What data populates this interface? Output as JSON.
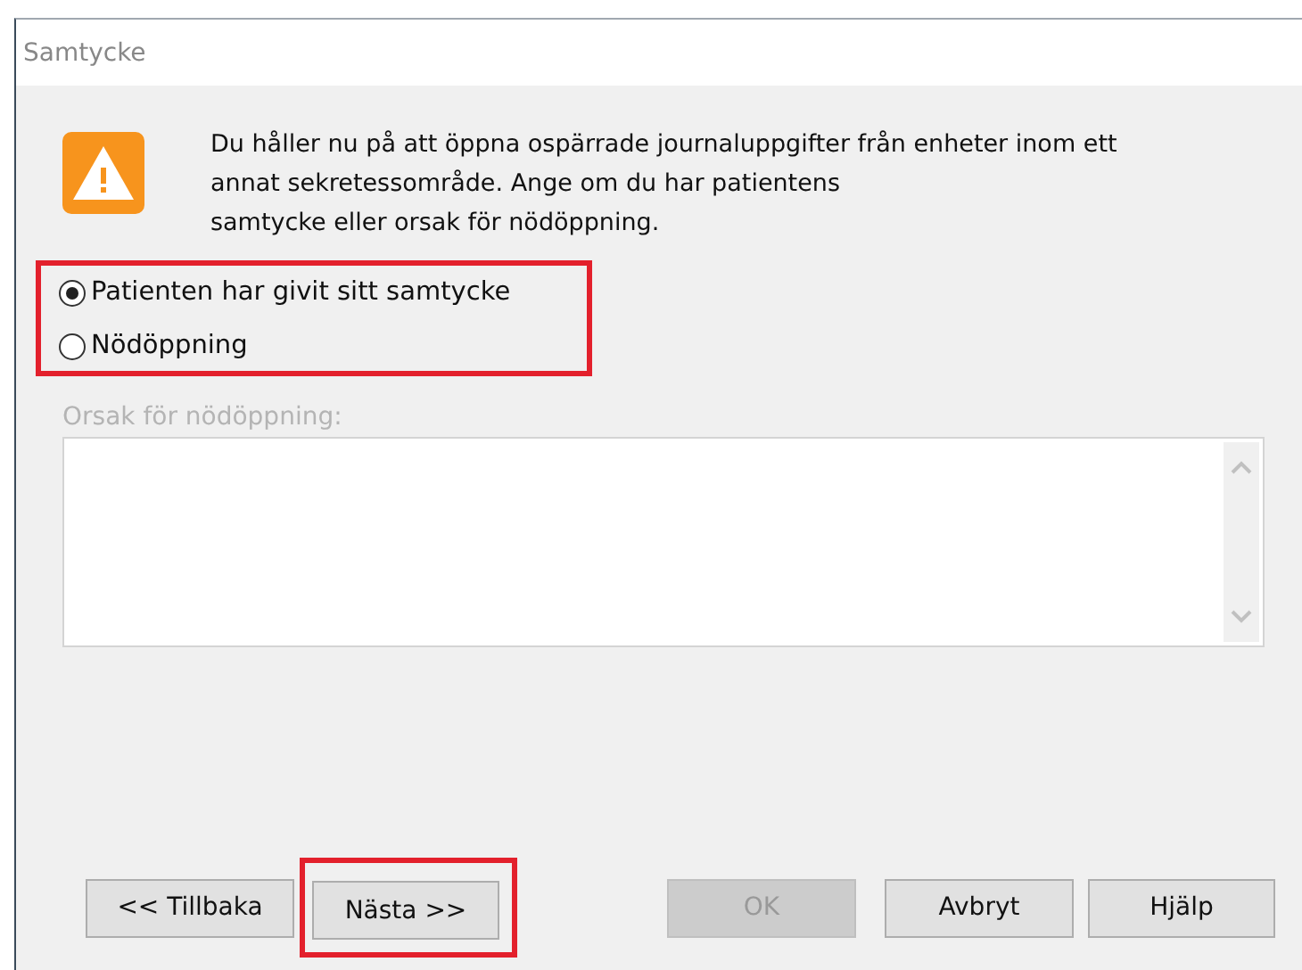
{
  "window": {
    "title": "Samtycke"
  },
  "message": "Du håller nu på att öppna ospärrade journaluppgifter från enheter inom ett\nannat sekretessområde. Ange om du har patientens\nsamtycke eller orsak för nödöppning.",
  "options": [
    {
      "label": "Patienten har givit sitt samtycke",
      "selected": true
    },
    {
      "label": "Nödöppning",
      "selected": false
    }
  ],
  "reason": {
    "label": "Orsak för nödöppning:",
    "disabled": true
  },
  "buttons": [
    {
      "label": "<< Tillbaka",
      "disabled": false,
      "highlighted": false
    },
    {
      "label": "Nästa >>",
      "disabled": false,
      "highlighted": true
    },
    {
      "label": "OK",
      "disabled": true,
      "highlighted": false
    },
    {
      "label": "Avbryt",
      "disabled": false,
      "highlighted": false
    },
    {
      "label": "Hjälp",
      "disabled": false,
      "highlighted": false
    }
  ]
}
